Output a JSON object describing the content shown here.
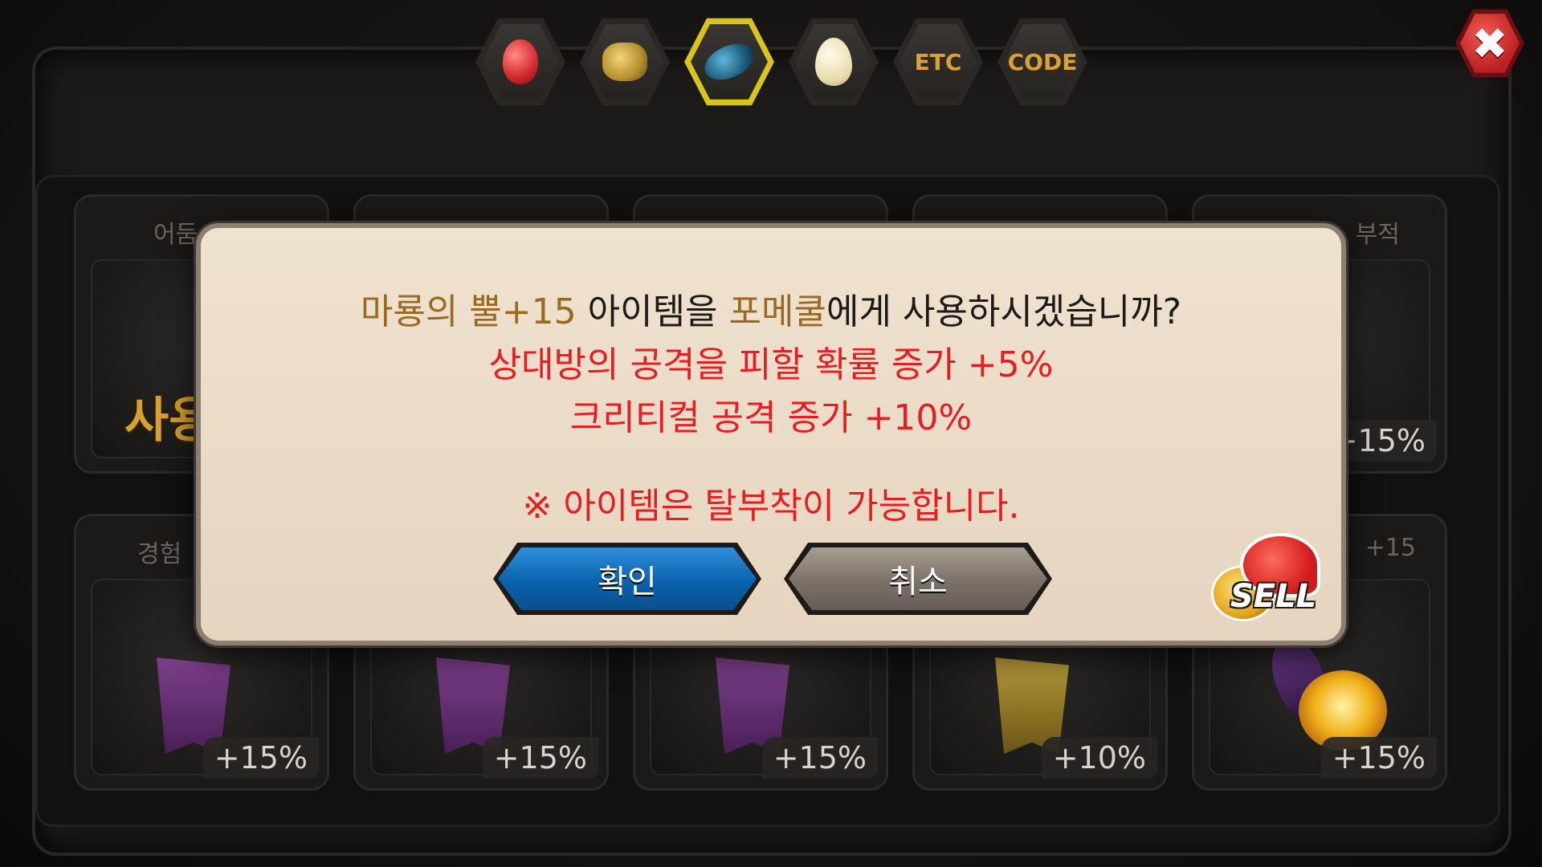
{
  "tabs": [
    {
      "id": "fruit",
      "icon": "fruit-icon",
      "label": ""
    },
    {
      "id": "ore",
      "icon": "ore-icon",
      "label": ""
    },
    {
      "id": "scale",
      "icon": "dragon-scale-icon",
      "label": "",
      "active": true
    },
    {
      "id": "egg",
      "icon": "egg-icon",
      "label": ""
    },
    {
      "id": "etc",
      "icon": "",
      "label": "ETC"
    },
    {
      "id": "code",
      "icon": "",
      "label": "CODE"
    }
  ],
  "inventory": {
    "row1": [
      {
        "name": "어둠 수호",
        "use_text": "사용",
        "pct": ""
      },
      {
        "name": "",
        "pct": ""
      },
      {
        "name": "",
        "pct": ""
      },
      {
        "name": "",
        "pct": ""
      },
      {
        "name": "부적",
        "pct": "+15%"
      }
    ],
    "row2": [
      {
        "name": "경험",
        "pct": "+15%"
      },
      {
        "name": "",
        "pct": "+15%"
      },
      {
        "name": "",
        "pct": "+15%"
      },
      {
        "name": "",
        "pct": "+10%"
      },
      {
        "name": "+15",
        "pct": "+15%"
      }
    ]
  },
  "dialog": {
    "item": "마룡의 뿔+15",
    "mid": " 아이템을 ",
    "target": "포메쿨",
    "tail": "에게 사용하시겠습니까?",
    "effect1": "상대방의 공격을 피할 확률 증가 +5%",
    "effect2": "크리티컬 공격 증가 +10%",
    "note": "※ 아이템은 탈부착이 가능합니다.",
    "confirm": "확인",
    "cancel": "취소"
  },
  "sell_label": "SELL",
  "close_label": "✖",
  "colors": {
    "accent_gold": "#9a6a22",
    "warning_red": "#ea1c22",
    "confirm_blue": "#0a62ae"
  }
}
